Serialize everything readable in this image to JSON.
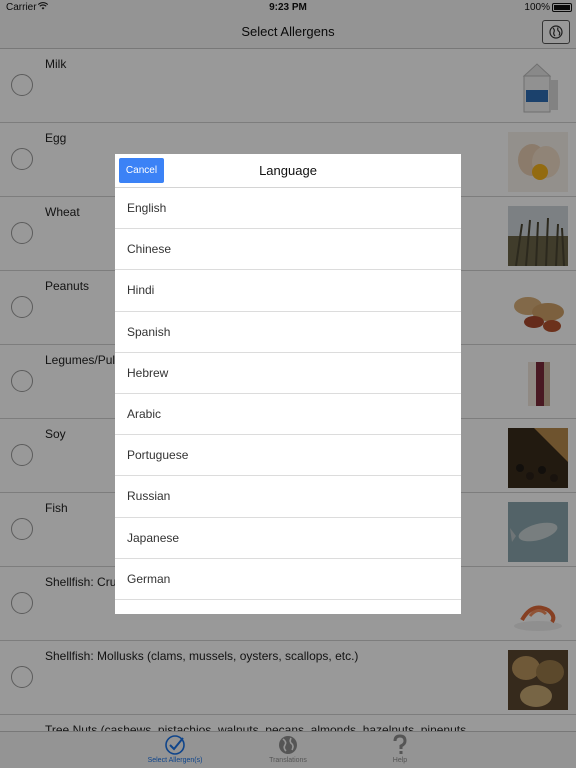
{
  "status_bar": {
    "carrier": "Carrier",
    "time": "9:23 PM",
    "battery": "100%"
  },
  "nav": {
    "title": "Select Allergens",
    "globe_icon": "globe-icon"
  },
  "allergens": [
    {
      "label": "Milk",
      "thumb": "milk-carton"
    },
    {
      "label": "Egg",
      "thumb": "egg"
    },
    {
      "label": "Wheat",
      "thumb": "wheat"
    },
    {
      "label": "Peanuts",
      "thumb": "peanuts"
    },
    {
      "label": "Legumes/Pul",
      "thumb": "legumes"
    },
    {
      "label": "Soy",
      "thumb": "soybeans"
    },
    {
      "label": "Fish",
      "thumb": "fish"
    },
    {
      "label": "Shellfish: Cru",
      "thumb": "shrimp"
    },
    {
      "label": "Shellfish: Mollusks (clams, mussels, oysters, scallops, etc.)",
      "thumb": "mollusks"
    },
    {
      "label": "Tree Nuts (cashews, pistachios, walnuts, pecans, almonds, hazelnuts, pinenuts,",
      "thumb": "tree-nuts"
    }
  ],
  "tabs": [
    {
      "label": "Select Allergen(s)",
      "icon": "checkmark-circle-icon",
      "active": true
    },
    {
      "label": "Translations",
      "icon": "globe-icon",
      "active": false
    },
    {
      "label": "Help",
      "icon": "question-mark-icon",
      "active": false
    }
  ],
  "modal": {
    "title": "Language",
    "cancel_label": "Cancel",
    "languages": [
      "English",
      "Chinese",
      "Hindi",
      "Spanish",
      "Hebrew",
      "Arabic",
      "Portuguese",
      "Russian",
      "Japanese",
      "German"
    ]
  },
  "colors": {
    "accent": "#3b82f6",
    "tab_active": "#1a73e8",
    "overlay": "rgba(0,0,0,0.40)"
  }
}
